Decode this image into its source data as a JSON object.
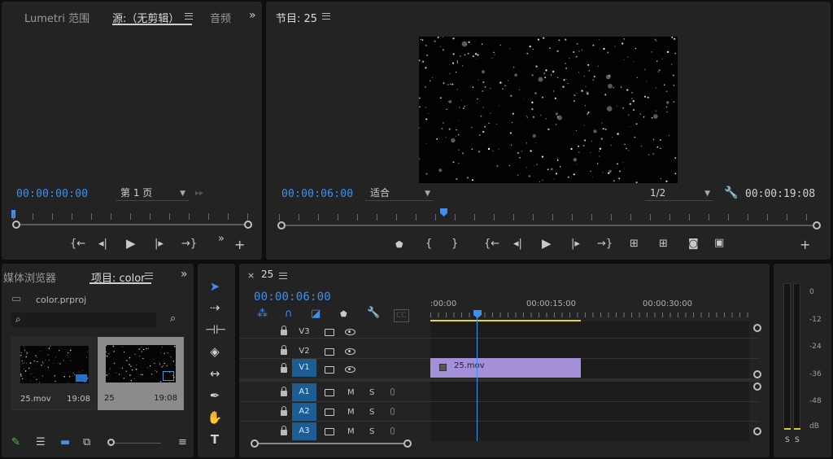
{
  "source_panel": {
    "tabs": [
      "Lumetri 范围",
      "源:（无剪辑）",
      "音频"
    ],
    "timecode": "00:00:00:00",
    "page_select": "第 1 页"
  },
  "program_panel": {
    "title": "节目: 25",
    "timecode": "00:00:06:00",
    "fit_select": "适合",
    "resolution_select": "1/2",
    "duration": "00:00:19:08"
  },
  "project_panel": {
    "tabs": [
      "媒体浏览器",
      "项目: color"
    ],
    "project_file": "color.prproj",
    "search_placeholder": "",
    "items": [
      {
        "name": "25.mov",
        "duration": "19:08",
        "selected": false
      },
      {
        "name": "25",
        "duration": "19:08",
        "selected": true
      }
    ]
  },
  "timeline": {
    "sequence_name": "25",
    "timecode": "00:00:06:00",
    "ruler_labels": [
      ":00:00",
      "00:00:15:00",
      "00:00:30:00"
    ],
    "video_tracks": [
      "V3",
      "V2",
      "V1"
    ],
    "audio_tracks": [
      "A1",
      "A2",
      "A3"
    ],
    "audio_mute": "M",
    "audio_solo": "S",
    "clip_name": "25.mov"
  },
  "audio_meter": {
    "scale": [
      "0",
      "-12",
      "-24",
      "-36",
      "-48",
      "dB"
    ],
    "solo_buttons": [
      "S",
      "S"
    ]
  },
  "colors": {
    "accent_blue": "#3e8ff0",
    "clip_purple": "#a48fd9",
    "track_highlight": "#1d5d93",
    "work_area_yellow": "#e8d820"
  }
}
